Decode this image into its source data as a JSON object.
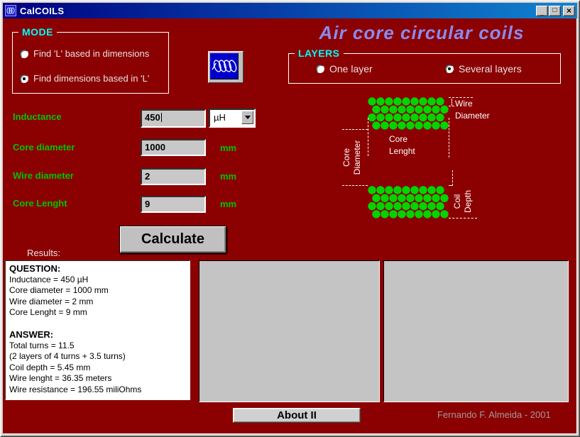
{
  "window": {
    "title": "CalCOILS",
    "controls": {
      "minimize": "_",
      "maximize": "□",
      "close": "×"
    }
  },
  "banner": {
    "title": "Air core circular coils"
  },
  "mode_group": {
    "caption": "MODE",
    "options": [
      {
        "label": "Find 'L' based in dimensions",
        "selected": false
      },
      {
        "label": "Find dimensions based in 'L'",
        "selected": true
      }
    ]
  },
  "layers_group": {
    "caption": "LAYERS",
    "options": [
      {
        "label": "One layer",
        "selected": false
      },
      {
        "label": "Several layers",
        "selected": true
      }
    ]
  },
  "inputs": [
    {
      "label": "Inductance",
      "value": "450",
      "unit": "µH"
    },
    {
      "label": "Core diameter",
      "value": "1000",
      "unit": "mm"
    },
    {
      "label": "Wire diameter",
      "value": "2",
      "unit": "mm"
    },
    {
      "label": "Core Lenght",
      "value": "9",
      "unit": "mm"
    }
  ],
  "diagram": {
    "grid": {
      "rows": 4,
      "cols": 9
    },
    "labels": {
      "wire_diameter": [
        "Wire",
        "Diameter"
      ],
      "core_lenght": [
        "Core",
        "Lenght"
      ],
      "core_diameter": [
        "Core",
        "Diameter"
      ],
      "coil_depth": [
        "Coil",
        "Depth"
      ]
    }
  },
  "calculate_button": "Calculate",
  "results": {
    "label": "Results:",
    "lines": [
      {
        "text": "QUESTION:",
        "bold": true
      },
      {
        "text": "Inductance = 450 µH",
        "bold": false
      },
      {
        "text": "Core diameter = 1000 mm",
        "bold": false
      },
      {
        "text": "Wire diameter = 2 mm",
        "bold": false
      },
      {
        "text": "Core Lenght = 9 mm",
        "bold": false
      },
      {
        "text": "",
        "bold": false
      },
      {
        "text": "ANSWER:",
        "bold": true
      },
      {
        "text": "Total turns = 11.5",
        "bold": false
      },
      {
        "text": "(2 layers of 4 turns + 3.5 turns)",
        "bold": false
      },
      {
        "text": "Coil depth = 5.45 mm",
        "bold": false
      },
      {
        "text": "Wire lenght = 36.35 meters",
        "bold": false
      },
      {
        "text": "Wire resistance = 196.55 miliOhms",
        "bold": false
      }
    ]
  },
  "about_button": "About II",
  "credit": "Fernando F. Almeida - 2001",
  "colors": {
    "background": "#8b0000",
    "accent_green": "#00c400",
    "accent_cyan": "#00ffff",
    "title_blue": "#8a8aee",
    "coil_green": "#00d400",
    "titlebar_start": "#000080",
    "titlebar_end": "#1084d0",
    "credit_gray": "#a29a9a"
  }
}
